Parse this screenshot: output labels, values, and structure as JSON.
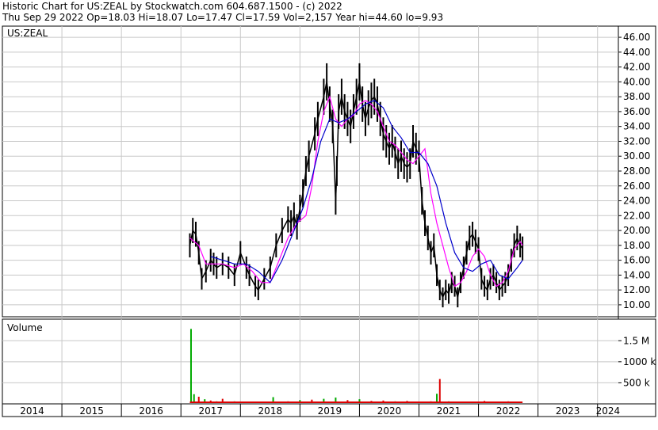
{
  "header": {
    "line1": "Historic Chart for US:ZEAL by Stockwatch.com 604.687.1500 - (c) 2022",
    "line2": "Thu Sep 29 2022  Op=18.03  Hi=18.07  Lo=17.47  Cl=17.59  Vol=2,157  Year hi=44.60  lo=9.93"
  },
  "colors": {
    "candle": "#000000",
    "ma_short": "#ff00ff",
    "ma_long": "#0000cc",
    "volume_up": "#00aa00",
    "volume_down": "#dd0000",
    "grid": "#c8c8c8"
  },
  "chart_data": [
    {
      "type": "line",
      "title": "US:ZEAL",
      "ylim": [
        8.5,
        47.5
      ],
      "y_ticks": [
        "46.00",
        "44.00",
        "42.00",
        "40.00",
        "38.00",
        "36.00",
        "34.00",
        "32.00",
        "30.00",
        "28.00",
        "26.00",
        "24.00",
        "22.00",
        "20.00",
        "18.00",
        "16.00",
        "14.00",
        "12.00",
        "10.00"
      ],
      "xlim": [
        2014.0,
        2024.35
      ],
      "x_ticks": [
        "2014",
        "2015",
        "2016",
        "2017",
        "2018",
        "2019",
        "2020",
        "2021",
        "2022",
        "2023",
        "2024"
      ],
      "grid": true,
      "series": [
        {
          "kind": "price",
          "x": [
            2017.15,
            2017.2,
            2017.25,
            2017.3,
            2017.35,
            2017.42,
            2017.5,
            2017.55,
            2017.6,
            2017.7,
            2017.8,
            2017.9,
            2018.0,
            2018.1,
            2018.15,
            2018.25,
            2018.3,
            2018.4,
            2018.5,
            2018.6,
            2018.7,
            2018.8,
            2018.85,
            2018.9,
            2018.95,
            2019.0,
            2019.05,
            2019.1,
            2019.15,
            2019.25,
            2019.3,
            2019.4,
            2019.45,
            2019.5,
            2019.55,
            2019.6,
            2019.62,
            2019.65,
            2019.7,
            2019.75,
            2019.8,
            2019.85,
            2019.9,
            2019.95,
            2020.0,
            2020.05,
            2020.1,
            2020.15,
            2020.2,
            2020.25,
            2020.3,
            2020.35,
            2020.4,
            2020.45,
            2020.5,
            2020.55,
            2020.6,
            2020.65,
            2020.7,
            2020.75,
            2020.8,
            2020.85,
            2020.9,
            2020.95,
            2021.0,
            2021.05,
            2021.1,
            2021.15,
            2021.2,
            2021.25,
            2021.3,
            2021.35,
            2021.4,
            2021.45,
            2021.5,
            2021.55,
            2021.6,
            2021.65,
            2021.7,
            2021.75,
            2021.8,
            2021.85,
            2021.9,
            2021.95,
            2022.0,
            2022.05,
            2022.1,
            2022.15,
            2022.2,
            2022.25,
            2022.3,
            2022.35,
            2022.4,
            2022.45,
            2022.5,
            2022.55,
            2022.6,
            2022.65,
            2022.7,
            2022.74
          ],
          "values": [
            18.0,
            20.0,
            19.5,
            17.0,
            13.5,
            14.5,
            16.0,
            15.5,
            15.0,
            15.5,
            15.0,
            14.0,
            17.0,
            15.0,
            14.0,
            12.5,
            12.0,
            13.5,
            15.0,
            18.0,
            20.0,
            21.5,
            21.0,
            22.0,
            20.5,
            23.0,
            25.0,
            28.0,
            30.0,
            33.0,
            35.0,
            38.0,
            40.0,
            37.0,
            34.0,
            24.0,
            28.0,
            36.0,
            38.0,
            36.0,
            35.0,
            34.0,
            36.0,
            38.0,
            40.0,
            37.0,
            35.0,
            36.5,
            37.5,
            38.0,
            37.0,
            35.0,
            33.0,
            32.0,
            31.0,
            32.0,
            30.5,
            29.0,
            30.0,
            29.0,
            28.5,
            29.0,
            32.0,
            31.0,
            30.0,
            24.0,
            21.0,
            19.0,
            17.0,
            18.0,
            14.0,
            12.0,
            11.0,
            12.0,
            11.5,
            13.0,
            12.5,
            11.0,
            13.0,
            15.0,
            17.0,
            19.0,
            19.5,
            18.5,
            17.5,
            13.5,
            12.5,
            12.0,
            13.5,
            14.0,
            13.0,
            12.0,
            12.5,
            13.0,
            14.0,
            16.0,
            18.0,
            19.0,
            18.0,
            17.59
          ]
        },
        {
          "kind": "ma_short",
          "x": [
            2017.15,
            2017.3,
            2017.42,
            2017.55,
            2017.7,
            2017.9,
            2018.05,
            2018.2,
            2018.35,
            2018.5,
            2018.65,
            2018.8,
            2018.95,
            2019.1,
            2019.2,
            2019.3,
            2019.4,
            2019.5,
            2019.6,
            2019.7,
            2019.8,
            2019.9,
            2020.0,
            2020.1,
            2020.2,
            2020.3,
            2020.4,
            2020.5,
            2020.6,
            2020.7,
            2020.8,
            2020.9,
            2021.0,
            2021.1,
            2021.2,
            2021.3,
            2021.4,
            2021.5,
            2021.6,
            2021.7,
            2021.8,
            2021.9,
            2022.0,
            2022.1,
            2022.2,
            2022.3,
            2022.4,
            2022.5,
            2022.6,
            2022.7,
            2022.74
          ],
          "values": [
            19.0,
            18.0,
            15.5,
            15.5,
            15.5,
            15.0,
            15.5,
            14.5,
            13.0,
            13.0,
            16.0,
            19.0,
            21.0,
            22.0,
            26.0,
            32.0,
            36.0,
            38.0,
            35.0,
            34.0,
            35.0,
            35.5,
            37.0,
            37.5,
            37.0,
            36.0,
            34.0,
            32.0,
            31.5,
            30.5,
            29.5,
            29.0,
            30.0,
            31.0,
            25.0,
            21.0,
            18.0,
            15.0,
            12.5,
            13.0,
            14.5,
            16.5,
            17.5,
            16.5,
            14.0,
            12.5,
            13.0,
            14.5,
            17.5,
            18.5,
            18.0
          ]
        },
        {
          "kind": "ma_long",
          "x": [
            2017.5,
            2017.7,
            2017.9,
            2018.1,
            2018.3,
            2018.5,
            2018.7,
            2018.9,
            2019.05,
            2019.2,
            2019.35,
            2019.5,
            2019.65,
            2019.8,
            2019.95,
            2020.1,
            2020.25,
            2020.4,
            2020.55,
            2020.7,
            2020.85,
            2021.0,
            2021.15,
            2021.3,
            2021.45,
            2021.6,
            2021.75,
            2021.9,
            2022.05,
            2022.2,
            2022.35,
            2022.5,
            2022.65,
            2022.74
          ],
          "values": [
            16.5,
            16.0,
            15.5,
            15.5,
            14.5,
            13.0,
            16.0,
            20.0,
            23.0,
            27.0,
            32.0,
            35.0,
            34.5,
            35.0,
            36.0,
            37.0,
            37.5,
            36.5,
            34.0,
            32.5,
            30.5,
            30.5,
            29.0,
            26.0,
            21.0,
            17.0,
            15.0,
            14.5,
            15.5,
            16.0,
            14.0,
            13.5,
            15.0,
            16.0
          ]
        }
      ]
    },
    {
      "type": "bar",
      "title": "Volume",
      "ylim": [
        0,
        1900000
      ],
      "y_ticks": [
        "1.5 M",
        "1000 k",
        "500 k"
      ],
      "x": [
        2017.17,
        2017.22,
        2017.3,
        2017.4,
        2017.5,
        2017.6,
        2017.7,
        2017.9,
        2018.1,
        2018.3,
        2018.55,
        2018.8,
        2019.0,
        2019.2,
        2019.4,
        2019.6,
        2019.8,
        2020.0,
        2020.2,
        2020.4,
        2020.6,
        2020.8,
        2021.0,
        2021.2,
        2021.3,
        2021.35,
        2021.5,
        2021.7,
        2021.9,
        2022.1,
        2022.3,
        2022.5,
        2022.7
      ],
      "values": [
        1780000,
        230000,
        170000,
        110000,
        80000,
        60000,
        120000,
        60000,
        50000,
        40000,
        160000,
        60000,
        90000,
        100000,
        120000,
        150000,
        90000,
        110000,
        70000,
        80000,
        60000,
        70000,
        50000,
        60000,
        240000,
        590000,
        60000,
        50000,
        40000,
        70000,
        40000,
        60000,
        50000
      ],
      "up": [
        true,
        true,
        false,
        true,
        false,
        true,
        false,
        true,
        false,
        true,
        true,
        false,
        true,
        false,
        true,
        true,
        false,
        true,
        false,
        false,
        true,
        false,
        true,
        false,
        true,
        false,
        true,
        false,
        true,
        false,
        true,
        false,
        true
      ]
    }
  ]
}
